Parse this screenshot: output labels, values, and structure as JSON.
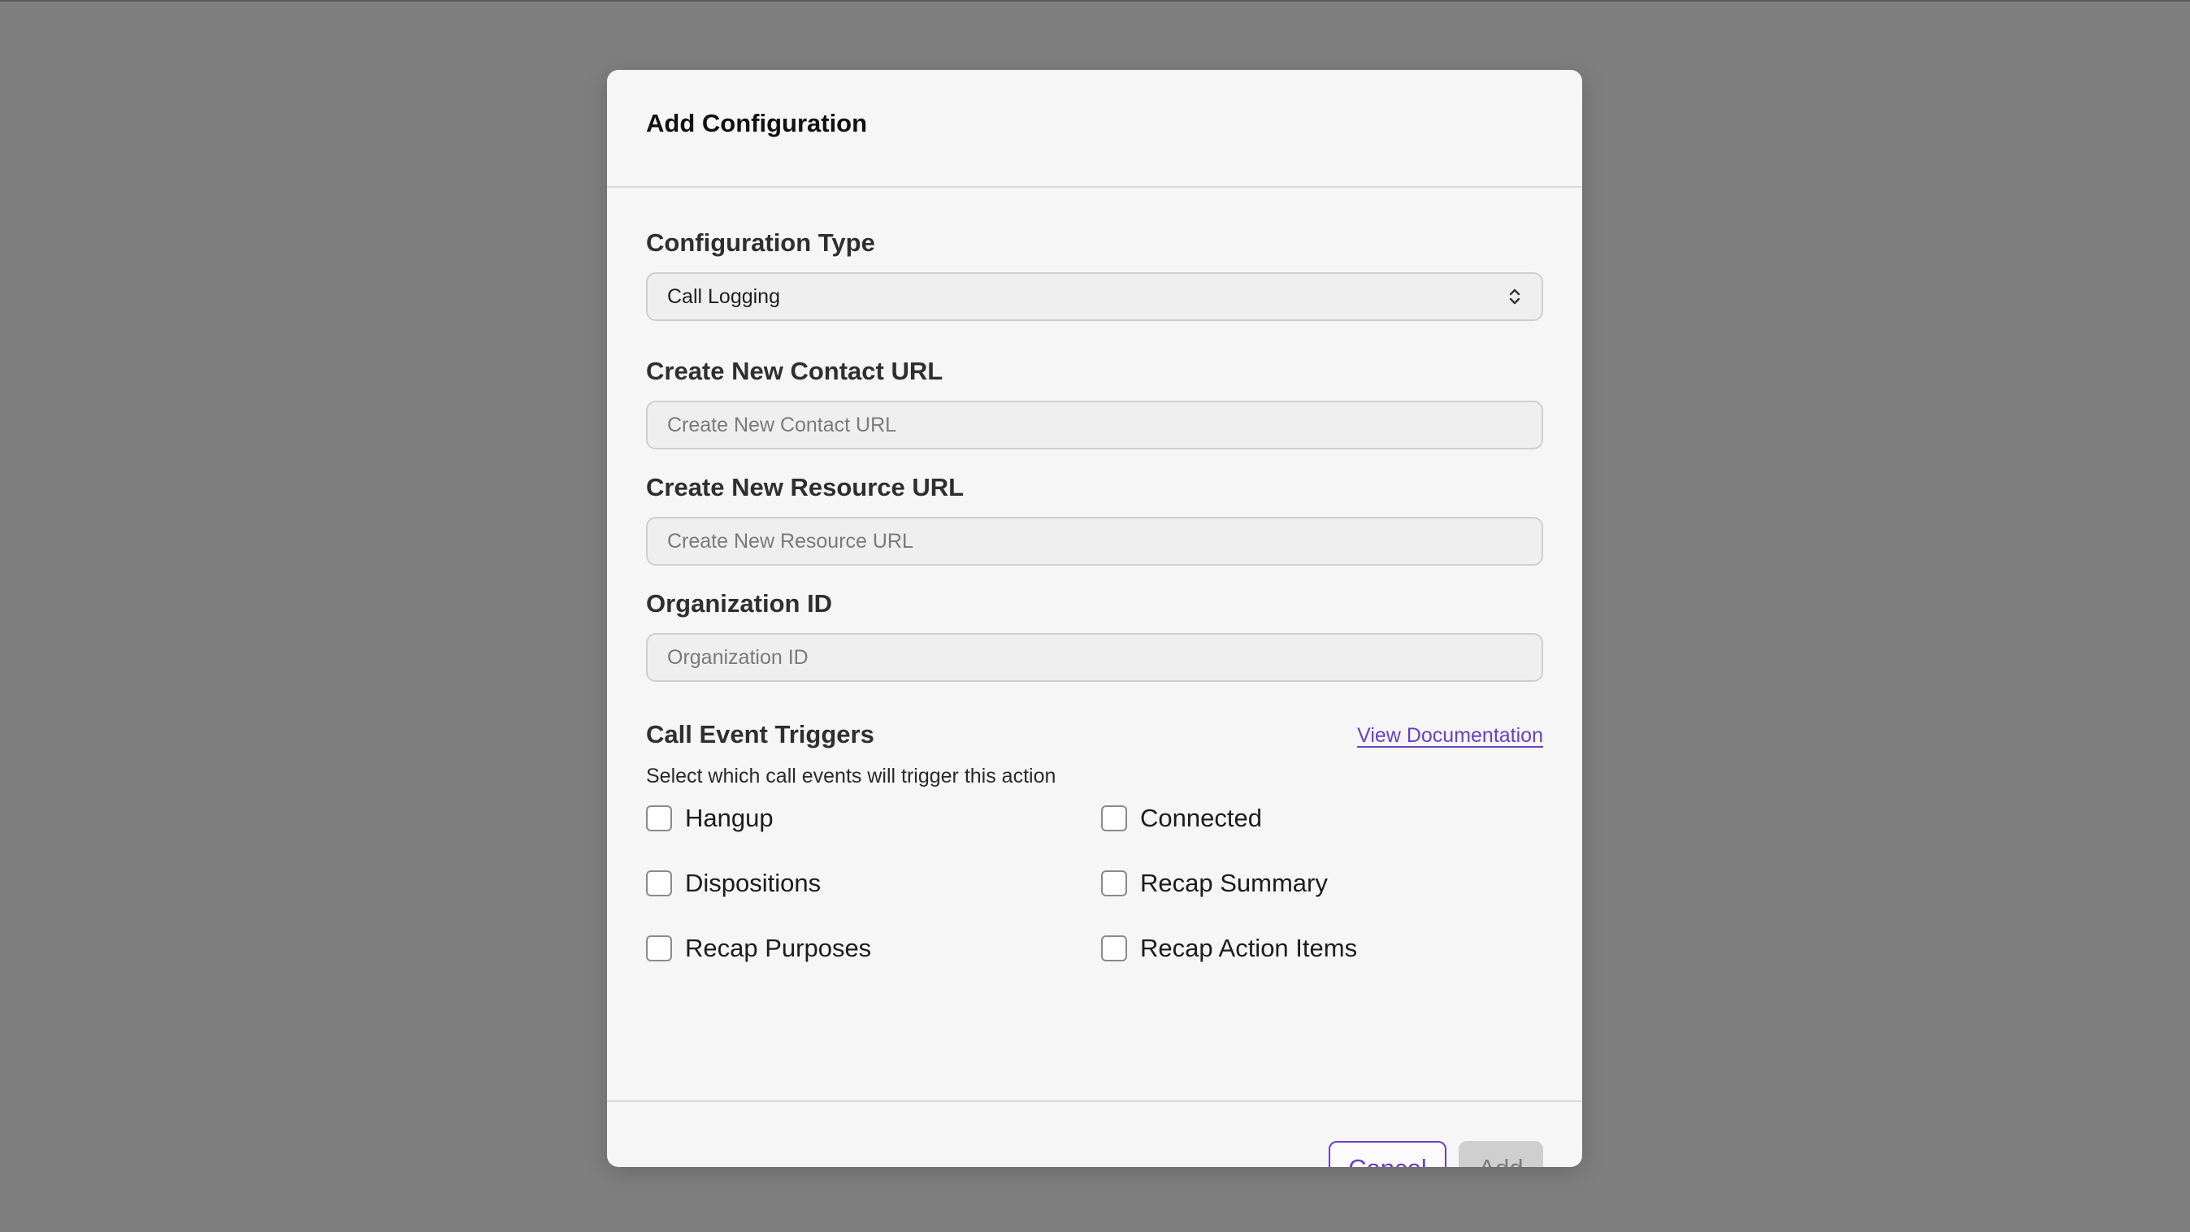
{
  "dialog": {
    "title": "Add Configuration"
  },
  "form": {
    "configuration_type": {
      "label": "Configuration Type",
      "selected": "Call Logging"
    },
    "contact_url": {
      "label": "Create New Contact URL",
      "placeholder": "Create New Contact URL",
      "value": ""
    },
    "resource_url": {
      "label": "Create New Resource URL",
      "placeholder": "Create New Resource URL",
      "value": ""
    },
    "organization_id": {
      "label": "Organization ID",
      "placeholder": "Organization ID",
      "value": ""
    }
  },
  "triggers": {
    "title": "Call Event Triggers",
    "doc_link": "View Documentation",
    "description": "Select which call events will trigger this action",
    "items": [
      {
        "label": "Hangup",
        "checked": false
      },
      {
        "label": "Connected",
        "checked": false
      },
      {
        "label": "Dispositions",
        "checked": false
      },
      {
        "label": "Recap Summary",
        "checked": false
      },
      {
        "label": "Recap Purposes",
        "checked": false
      },
      {
        "label": "Recap Action Items",
        "checked": false
      }
    ]
  },
  "footer": {
    "cancel_label": "Cancel",
    "add_label": "Add"
  },
  "colors": {
    "accent": "#6a3fc4",
    "overlay": "#7f7f7f",
    "disabled": "#cfcfcf"
  }
}
